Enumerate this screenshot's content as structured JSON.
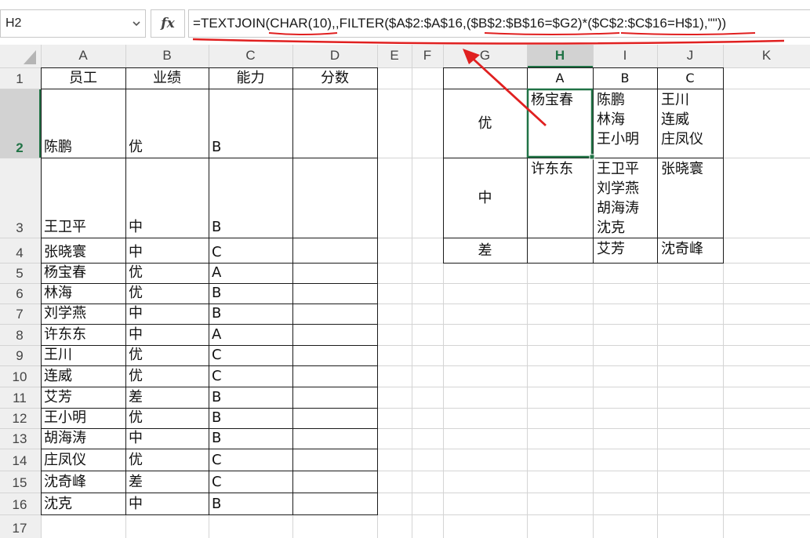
{
  "formula_bar": {
    "name_box": "H2",
    "fx_label": "fx",
    "formula": "=TEXTJOIN(CHAR(10),,FILTER($A$2:$A$16,($B$2:$B$16=$G2)*($C$2:$C$16=H$1),\"\"))"
  },
  "columns": [
    "A",
    "B",
    "C",
    "D",
    "E",
    "F",
    "G",
    "H",
    "I",
    "J",
    "K"
  ],
  "rows": [
    "1",
    "2",
    "3",
    "4",
    "5",
    "6",
    "7",
    "8",
    "9",
    "10",
    "11",
    "12",
    "13",
    "14",
    "15",
    "16",
    "17"
  ],
  "selected": {
    "column": "H",
    "row": "2",
    "cell": "H2"
  },
  "table": {
    "headers": [
      "员工",
      "业绩",
      "能力",
      "分数"
    ],
    "rows": [
      [
        "陈鹏",
        "优",
        "B",
        ""
      ],
      [
        "王卫平",
        "中",
        "B",
        ""
      ],
      [
        "张晓寰",
        "中",
        "C",
        ""
      ],
      [
        "杨宝春",
        "优",
        "A",
        ""
      ],
      [
        "林海",
        "优",
        "B",
        ""
      ],
      [
        "刘学燕",
        "中",
        "B",
        ""
      ],
      [
        "许东东",
        "中",
        "A",
        ""
      ],
      [
        "王川",
        "优",
        "C",
        ""
      ],
      [
        "连威",
        "优",
        "C",
        ""
      ],
      [
        "艾芳",
        "差",
        "B",
        ""
      ],
      [
        "王小明",
        "优",
        "B",
        ""
      ],
      [
        "胡海涛",
        "中",
        "B",
        ""
      ],
      [
        "庄凤仪",
        "优",
        "C",
        ""
      ],
      [
        "沈奇峰",
        "差",
        "C",
        ""
      ],
      [
        "沈克",
        "中",
        "B",
        ""
      ]
    ]
  },
  "result": {
    "col_headers": [
      "A",
      "B",
      "C"
    ],
    "row_labels": [
      "优",
      "中",
      "差"
    ],
    "cells": [
      [
        "杨宝春",
        "陈鹏\n林海\n王小明",
        "王川\n连威\n庄凤仪"
      ],
      [
        "许东东",
        "王卫平\n刘学燕\n胡海涛\n沈克",
        "张晓寰"
      ],
      [
        "",
        "艾芳",
        "沈奇峰"
      ]
    ]
  },
  "colors": {
    "accent_red": "#e02020",
    "excel_green": "#217346",
    "header_bg": "#efefef",
    "grid": "#d4d4d4"
  }
}
